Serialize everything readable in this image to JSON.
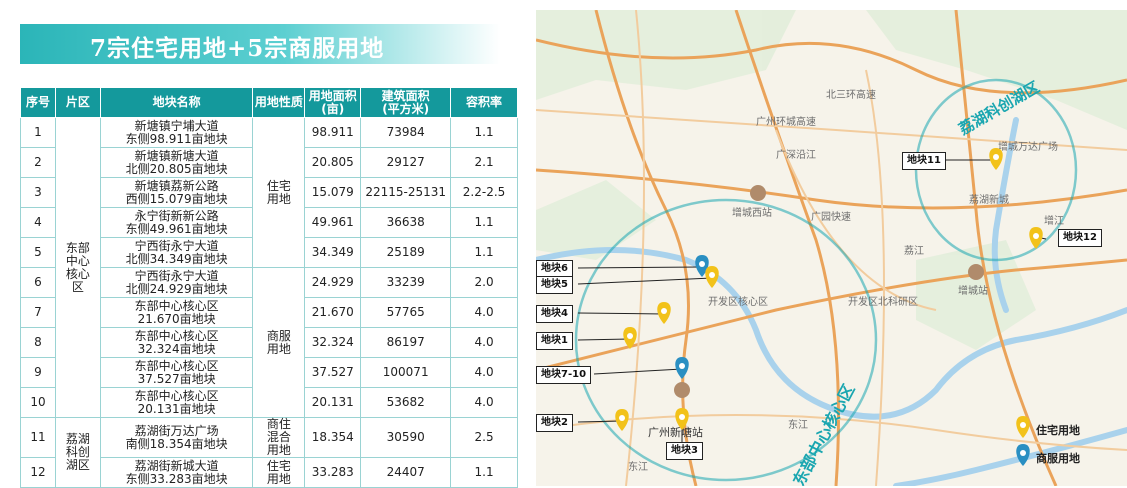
{
  "title": "7宗住宅用地+5宗商服用地",
  "table": {
    "headers": [
      "序号",
      "片区",
      "地块名称",
      "用地性质",
      "用地面积\n(亩)",
      "建筑面积\n(平方米)",
      "容积率"
    ],
    "district_east": "东部中心核心区",
    "district_lihu": "荔湖科创湖区",
    "type_res": "住宅用地",
    "type_com": "商服用地",
    "type_mixed": "商住混合用地",
    "type_res2": "住宅用地",
    "rows": [
      {
        "no": "1",
        "name": "新塘镇宁埔大道\n东侧98.911亩地块",
        "area": "98.911",
        "floor": "73984",
        "far": "1.1"
      },
      {
        "no": "2",
        "name": "新塘镇新塘大道\n北侧20.805亩地块",
        "area": "20.805",
        "floor": "29127",
        "far": "2.1"
      },
      {
        "no": "3",
        "name": "新塘镇荔新公路\n西侧15.079亩地块",
        "area": "15.079",
        "floor": "22115-25131",
        "far": "2.2-2.5"
      },
      {
        "no": "4",
        "name": "永宁街新新公路\n东侧49.961亩地块",
        "area": "49.961",
        "floor": "36638",
        "far": "1.1"
      },
      {
        "no": "5",
        "name": "宁西街永宁大道\n北侧34.349亩地块",
        "area": "34.349",
        "floor": "25189",
        "far": "1.1"
      },
      {
        "no": "6",
        "name": "宁西街永宁大道\n北侧24.929亩地块",
        "area": "24.929",
        "floor": "33239",
        "far": "2.0"
      },
      {
        "no": "7",
        "name": "东部中心核心区\n21.670亩地块",
        "area": "21.670",
        "floor": "57765",
        "far": "4.0"
      },
      {
        "no": "8",
        "name": "东部中心核心区\n32.324亩地块",
        "area": "32.324",
        "floor": "86197",
        "far": "4.0"
      },
      {
        "no": "9",
        "name": "东部中心核心区\n37.527亩地块",
        "area": "37.527",
        "floor": "100071",
        "far": "4.0"
      },
      {
        "no": "10",
        "name": "东部中心核心区\n20.131亩地块",
        "area": "20.131",
        "floor": "53682",
        "far": "4.0"
      },
      {
        "no": "11",
        "name": "荔湖街万达广场\n南侧18.354亩地块",
        "area": "18.354",
        "floor": "30590",
        "far": "2.5"
      },
      {
        "no": "12",
        "name": "荔湖街新城大道\n东侧33.283亩地块",
        "area": "33.283",
        "floor": "24407",
        "far": "1.1"
      }
    ]
  },
  "map": {
    "zone_lihu": "荔湖科创湖区",
    "zone_east": "东部中心核心区",
    "places": {
      "gz_ring": "广州环城高速",
      "guangshen": "广深沿江",
      "north_ring": "北三环高速",
      "guangyuan": "广园快速",
      "zengcheng_west": "增城西站",
      "zengcheng": "增城站",
      "kaifa": "开发区核心区",
      "kaifa2": "开发区北科研区",
      "gz_xintang": "广州新塘站",
      "dongjiang": "东江",
      "dongjiang2": "东江",
      "wanda": "增城万达广场",
      "lihu": "荔湖新城",
      "zengjiang": "增江",
      "lijiang": "荔江"
    },
    "labels": [
      "地块6",
      "地块5",
      "地块4",
      "地块1",
      "地块7-10",
      "地块2",
      "地块3",
      "地块11",
      "地块12"
    ],
    "legend": {
      "res": "住宅用地",
      "com": "商服用地"
    },
    "colors": {
      "res": "#f2c21a",
      "com": "#2a8fc2",
      "zone": "#1aa6b0"
    }
  }
}
